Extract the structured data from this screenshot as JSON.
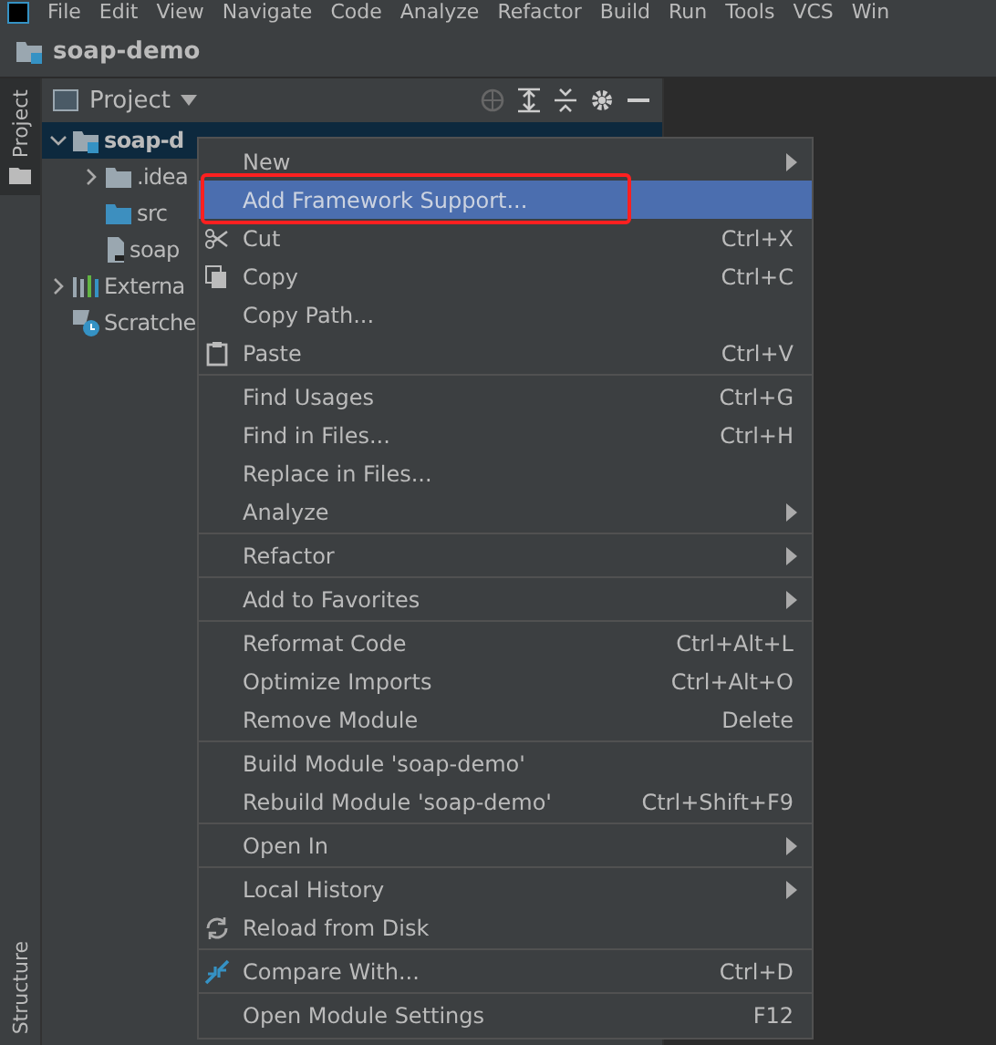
{
  "menu_bar": [
    "File",
    "Edit",
    "View",
    "Navigate",
    "Code",
    "Analyze",
    "Refactor",
    "Build",
    "Run",
    "Tools",
    "VCS",
    "Win"
  ],
  "title_bar": {
    "project": "soap-demo"
  },
  "side_tabs": {
    "top": "Project",
    "bottom": "Structure"
  },
  "project_panel": {
    "title": "Project",
    "tree": [
      {
        "label": "soap-d",
        "kind": "module",
        "selected": true,
        "expanded": true,
        "children": [
          {
            "label": ".idea",
            "kind": "folder",
            "selected": false,
            "expanded": false
          },
          {
            "label": "src",
            "kind": "source",
            "selected": false
          },
          {
            "label": "soap",
            "kind": "file",
            "selected": false
          }
        ]
      },
      {
        "label": "Externa",
        "kind": "libraries",
        "selected": false,
        "expanded": false
      },
      {
        "label": "Scratche",
        "kind": "scratches",
        "selected": false
      }
    ]
  },
  "context_menu": [
    [
      {
        "label": "New",
        "submenu": true,
        "selected": false
      },
      {
        "label": "Add Framework Support...",
        "selected": true,
        "highlighted": true
      },
      {
        "label": "Cut",
        "shortcut": "Ctrl+X",
        "selected": false
      },
      {
        "label": "Copy",
        "shortcut": "Ctrl+C",
        "selected": false
      },
      {
        "label": "Copy Path...",
        "selected": false
      },
      {
        "label": "Paste",
        "shortcut": "Ctrl+V",
        "selected": false
      }
    ],
    [
      {
        "label": "Find Usages",
        "shortcut": "Ctrl+G",
        "selected": false
      },
      {
        "label": "Find in Files...",
        "shortcut": "Ctrl+H",
        "selected": false
      },
      {
        "label": "Replace in Files...",
        "selected": false
      },
      {
        "label": "Analyze",
        "submenu": true,
        "selected": false
      }
    ],
    [
      {
        "label": "Refactor",
        "submenu": true,
        "selected": false
      }
    ],
    [
      {
        "label": "Add to Favorites",
        "submenu": true,
        "selected": false
      }
    ],
    [
      {
        "label": "Reformat Code",
        "shortcut": "Ctrl+Alt+L",
        "selected": false
      },
      {
        "label": "Optimize Imports",
        "shortcut": "Ctrl+Alt+O",
        "selected": false
      },
      {
        "label": "Remove Module",
        "shortcut": "Delete",
        "selected": false
      }
    ],
    [
      {
        "label": "Build Module 'soap-demo'",
        "selected": false
      },
      {
        "label": "Rebuild Module 'soap-demo'",
        "shortcut": "Ctrl+Shift+F9",
        "selected": false
      }
    ],
    [
      {
        "label": "Open In",
        "submenu": true,
        "selected": false
      }
    ],
    [
      {
        "label": "Local History",
        "submenu": true,
        "selected": false
      },
      {
        "label": "Reload from Disk",
        "selected": false
      }
    ],
    [
      {
        "label": "Compare With...",
        "shortcut": "Ctrl+D",
        "selected": false
      }
    ],
    [
      {
        "label": "Open Module Settings",
        "shortcut": "F12",
        "selected": false
      }
    ]
  ]
}
